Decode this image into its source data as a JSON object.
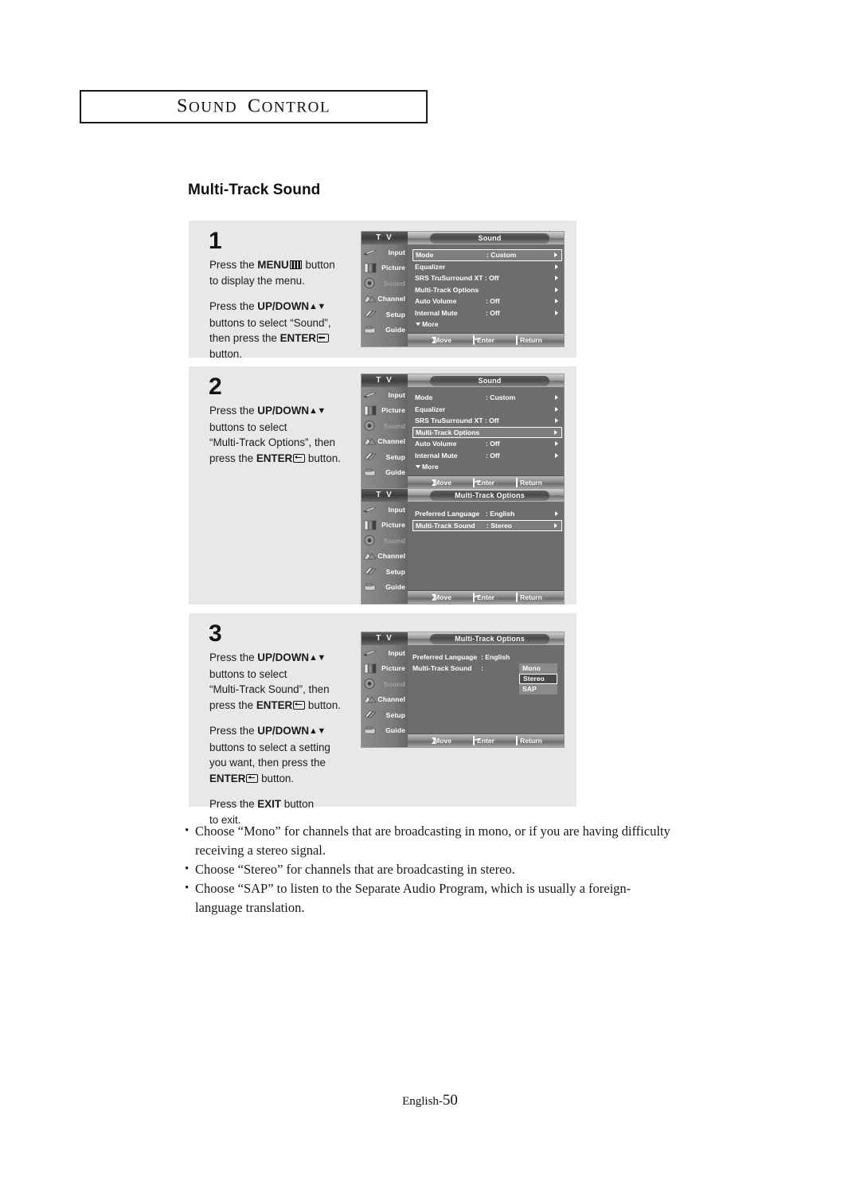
{
  "chapter": {
    "title_first_cap": "S",
    "title_rest": "OUND",
    "title2_first_cap": "C",
    "title2_rest": "ONTROL",
    "full": "SOUND CONTROL"
  },
  "section": {
    "heading": "Multi-Track Sound"
  },
  "steps": [
    {
      "number": "1",
      "paragraphs": [
        {
          "parts": [
            {
              "t": "text",
              "v": "Press the "
            },
            {
              "t": "bold",
              "v": "MENU"
            },
            {
              "t": "icon",
              "v": "menu-icon"
            },
            {
              "t": "text",
              "v": " button"
            },
            {
              "t": "br"
            },
            {
              "t": "text",
              "v": "to display the menu."
            }
          ]
        },
        {
          "parts": [
            {
              "t": "text",
              "v": "Press the "
            },
            {
              "t": "bold",
              "v": "UP/DOWN"
            },
            {
              "t": "arrows",
              "v": "▲▼"
            },
            {
              "t": "br"
            },
            {
              "t": "text",
              "v": "buttons to select “Sound”,"
            },
            {
              "t": "br"
            },
            {
              "t": "text",
              "v": "then press the "
            },
            {
              "t": "bold",
              "v": "ENTER"
            },
            {
              "t": "icon",
              "v": "enter-icon"
            },
            {
              "t": "br"
            },
            {
              "t": "text",
              "v": "button."
            }
          ]
        }
      ]
    },
    {
      "number": "2",
      "paragraphs": [
        {
          "parts": [
            {
              "t": "text",
              "v": "Press the "
            },
            {
              "t": "bold",
              "v": "UP/DOWN"
            },
            {
              "t": "arrows",
              "v": "▲▼"
            },
            {
              "t": "br"
            },
            {
              "t": "text",
              "v": "buttons to select"
            },
            {
              "t": "br"
            },
            {
              "t": "text",
              "v": "“Multi-Track Options”, then"
            },
            {
              "t": "br"
            },
            {
              "t": "text",
              "v": "press the "
            },
            {
              "t": "bold",
              "v": "ENTER"
            },
            {
              "t": "icon",
              "v": "enter-icon"
            },
            {
              "t": "text",
              "v": "  button."
            }
          ]
        }
      ]
    },
    {
      "number": "3",
      "paragraphs": [
        {
          "parts": [
            {
              "t": "text",
              "v": "Press the "
            },
            {
              "t": "bold",
              "v": "UP/DOWN"
            },
            {
              "t": "arrows",
              "v": "▲▼"
            },
            {
              "t": "br"
            },
            {
              "t": "text",
              "v": "buttons to select"
            },
            {
              "t": "br"
            },
            {
              "t": "text",
              "v": "“Multi-Track Sound”, then"
            },
            {
              "t": "br"
            },
            {
              "t": "text",
              "v": "press the "
            },
            {
              "t": "bold",
              "v": "ENTER"
            },
            {
              "t": "icon",
              "v": "enter-icon"
            },
            {
              "t": "text",
              "v": "  button."
            }
          ]
        },
        {
          "parts": [
            {
              "t": "text",
              "v": "Press the "
            },
            {
              "t": "bold",
              "v": "UP/DOWN"
            },
            {
              "t": "arrows",
              "v": "▲▼"
            },
            {
              "t": "br"
            },
            {
              "t": "text",
              "v": "buttons to select a setting"
            },
            {
              "t": "br"
            },
            {
              "t": "text",
              "v": "you want, then press the"
            },
            {
              "t": "br"
            },
            {
              "t": "bold",
              "v": "ENTER"
            },
            {
              "t": "icon",
              "v": "enter-icon"
            },
            {
              "t": "text",
              "v": "  button."
            }
          ]
        },
        {
          "parts": [
            {
              "t": "text",
              "v": "Press the "
            },
            {
              "t": "bold",
              "v": "EXIT"
            },
            {
              "t": "text",
              "v": " button"
            },
            {
              "t": "br"
            },
            {
              "t": "text",
              "v": "to exit."
            }
          ]
        }
      ]
    }
  ],
  "tv_common": {
    "brand": "T V",
    "sidebar": [
      {
        "label": "Input",
        "icon": "input-icon",
        "dim": false
      },
      {
        "label": "Picture",
        "icon": "picture-icon",
        "dim": false
      },
      {
        "label": "Sound",
        "icon": "sound-icon",
        "dim": true
      },
      {
        "label": "Channel",
        "icon": "channel-icon",
        "dim": false
      },
      {
        "label": "Setup",
        "icon": "setup-icon",
        "dim": false
      },
      {
        "label": "Guide",
        "icon": "guide-icon",
        "dim": false
      }
    ],
    "bottom_bar": [
      {
        "icon": "updown-icon",
        "label": "Move"
      },
      {
        "icon": "enter-icon",
        "label": "Enter"
      },
      {
        "icon": "menu-icon",
        "label": "Return"
      }
    ]
  },
  "tv_screens": [
    {
      "id": "tv-screen-1",
      "title": "Sound",
      "rows": [
        {
          "label": "Mode",
          "value": ": Custom",
          "arrow": true,
          "selected": true
        },
        {
          "label": "Equalizer",
          "value": "",
          "arrow": true,
          "selected": false
        },
        {
          "label": "SRS TruSurround XT : Off",
          "value": "",
          "arrow": true,
          "selected": false
        },
        {
          "label": "Multi-Track Options",
          "value": "",
          "arrow": true,
          "selected": false
        },
        {
          "label": "Auto Volume",
          "value": ": Off",
          "arrow": true,
          "selected": false
        },
        {
          "label": "Internal Mute",
          "value": ": Off",
          "arrow": true,
          "selected": false
        }
      ],
      "more": "More"
    },
    {
      "id": "tv-screen-2",
      "title": "Sound",
      "rows": [
        {
          "label": "Mode",
          "value": ": Custom",
          "arrow": true,
          "selected": false
        },
        {
          "label": "Equalizer",
          "value": "",
          "arrow": true,
          "selected": false
        },
        {
          "label": "SRS TruSurround XT : Off",
          "value": "",
          "arrow": true,
          "selected": false
        },
        {
          "label": "Multi-Track Options",
          "value": "",
          "arrow": true,
          "selected": true
        },
        {
          "label": "Auto Volume",
          "value": ": Off",
          "arrow": true,
          "selected": false
        },
        {
          "label": "Internal Mute",
          "value": ": Off",
          "arrow": true,
          "selected": false
        }
      ],
      "more": "More"
    },
    {
      "id": "tv-screen-3",
      "title": "Multi-Track Options",
      "rows": [
        {
          "label": "Preferred Language",
          "value": ": English",
          "arrow": true,
          "selected": false
        },
        {
          "label": "Multi-Track Sound",
          "value": ": Stereo",
          "arrow": true,
          "selected": true
        }
      ],
      "more": ""
    },
    {
      "id": "tv-screen-4",
      "title": "Multi-Track Options",
      "rows": [
        {
          "label": "Preferred Language",
          "value": ": English",
          "arrow": false,
          "selected": false
        },
        {
          "label": "Multi-Track Sound",
          "value": ":",
          "arrow": false,
          "selected": false
        }
      ],
      "dropdown": [
        {
          "label": "Mono",
          "selected": false
        },
        {
          "label": "Stereo",
          "selected": true
        },
        {
          "label": "SAP",
          "selected": false
        }
      ],
      "more": ""
    }
  ],
  "bullets": [
    "Choose “Mono” for channels that are broadcasting in mono, or if you are having difficulty receiving a stereo signal.",
    "Choose “Stereo” for channels that are broadcasting in stereo.",
    "Choose “SAP” to listen to the Separate Audio Program, which is usually a foreign-language translation."
  ],
  "footer": {
    "label": "English-",
    "page": "50"
  }
}
